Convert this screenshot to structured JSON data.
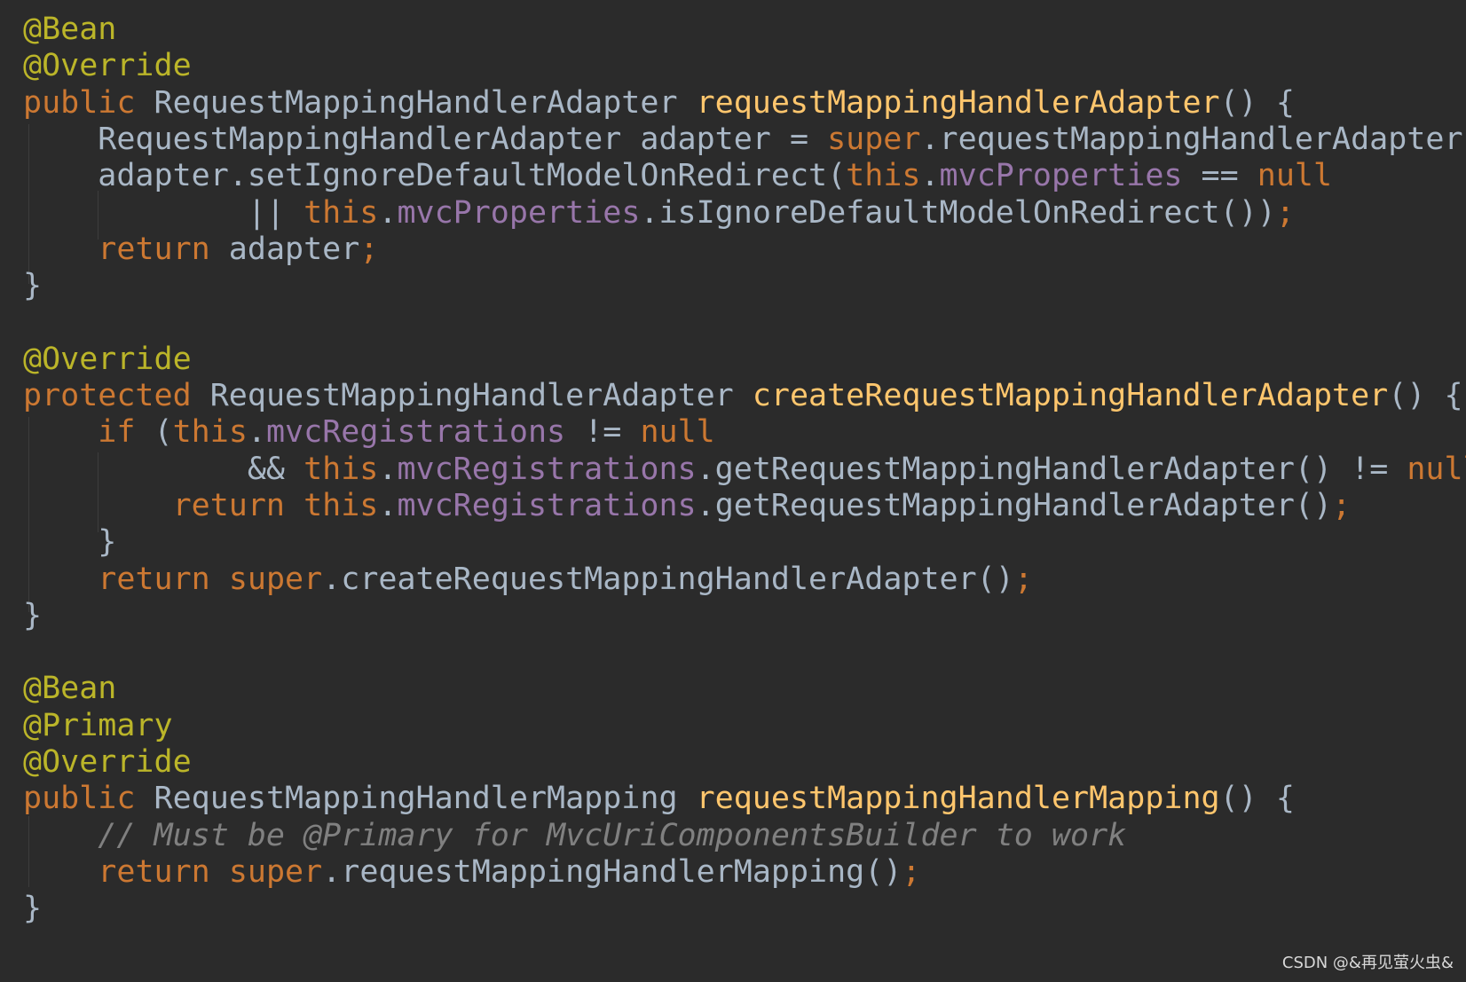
{
  "editor": {
    "background": "#2b2b2b",
    "colors": {
      "annotation": "#bbb529",
      "keyword": "#cc7832",
      "method": "#ffc66d",
      "field": "#9876aa",
      "comment": "#808080",
      "text": "#a9b7c6"
    },
    "lines": [
      [
        {
          "t": "@Bean",
          "c": "ann"
        }
      ],
      [
        {
          "t": "@Override",
          "c": "ann"
        }
      ],
      [
        {
          "t": "public",
          "c": "kw"
        },
        {
          "t": " RequestMappingHandlerAdapter ",
          "c": "plain"
        },
        {
          "t": "requestMappingHandlerAdapter",
          "c": "fn"
        },
        {
          "t": "() {",
          "c": "plain"
        }
      ],
      [
        {
          "t": "    RequestMappingHandlerAdapter adapter = ",
          "c": "plain"
        },
        {
          "t": "super",
          "c": "kw"
        },
        {
          "t": ".requestMappingHandlerAdapter()",
          "c": "plain"
        },
        {
          "t": ";",
          "c": "kw"
        }
      ],
      [
        {
          "t": "    adapter.setIgnoreDefaultModelOnRedirect(",
          "c": "plain"
        },
        {
          "t": "this",
          "c": "kw"
        },
        {
          "t": ".",
          "c": "plain"
        },
        {
          "t": "mvcProperties",
          "c": "field"
        },
        {
          "t": " == ",
          "c": "plain"
        },
        {
          "t": "null",
          "c": "kw"
        }
      ],
      [
        {
          "t": "            || ",
          "c": "plain"
        },
        {
          "t": "this",
          "c": "kw"
        },
        {
          "t": ".",
          "c": "plain"
        },
        {
          "t": "mvcProperties",
          "c": "field"
        },
        {
          "t": ".isIgnoreDefaultModelOnRedirect())",
          "c": "plain"
        },
        {
          "t": ";",
          "c": "kw"
        }
      ],
      [
        {
          "t": "    ",
          "c": "plain"
        },
        {
          "t": "return",
          "c": "kw"
        },
        {
          "t": " adapter",
          "c": "plain"
        },
        {
          "t": ";",
          "c": "kw"
        }
      ],
      [
        {
          "t": "}",
          "c": "plain"
        }
      ],
      [],
      [
        {
          "t": "@Override",
          "c": "ann"
        }
      ],
      [
        {
          "t": "protected",
          "c": "kw"
        },
        {
          "t": " RequestMappingHandlerAdapter ",
          "c": "plain"
        },
        {
          "t": "createRequestMappingHandlerAdapter",
          "c": "fn"
        },
        {
          "t": "() {",
          "c": "plain"
        }
      ],
      [
        {
          "t": "    ",
          "c": "plain"
        },
        {
          "t": "if",
          "c": "kw"
        },
        {
          "t": " (",
          "c": "plain"
        },
        {
          "t": "this",
          "c": "kw"
        },
        {
          "t": ".",
          "c": "plain"
        },
        {
          "t": "mvcRegistrations",
          "c": "field"
        },
        {
          "t": " != ",
          "c": "plain"
        },
        {
          "t": "null",
          "c": "kw"
        }
      ],
      [
        {
          "t": "            && ",
          "c": "plain"
        },
        {
          "t": "this",
          "c": "kw"
        },
        {
          "t": ".",
          "c": "plain"
        },
        {
          "t": "mvcRegistrations",
          "c": "field"
        },
        {
          "t": ".getRequestMappingHandlerAdapter() != ",
          "c": "plain"
        },
        {
          "t": "null",
          "c": "kw"
        },
        {
          "t": ") {",
          "c": "plain"
        }
      ],
      [
        {
          "t": "        ",
          "c": "plain"
        },
        {
          "t": "return",
          "c": "kw"
        },
        {
          "t": " ",
          "c": "plain"
        },
        {
          "t": "this",
          "c": "kw"
        },
        {
          "t": ".",
          "c": "plain"
        },
        {
          "t": "mvcRegistrations",
          "c": "field"
        },
        {
          "t": ".getRequestMappingHandlerAdapter()",
          "c": "plain"
        },
        {
          "t": ";",
          "c": "kw"
        }
      ],
      [
        {
          "t": "    }",
          "c": "plain"
        }
      ],
      [
        {
          "t": "    ",
          "c": "plain"
        },
        {
          "t": "return",
          "c": "kw"
        },
        {
          "t": " ",
          "c": "plain"
        },
        {
          "t": "super",
          "c": "kw"
        },
        {
          "t": ".createRequestMappingHandlerAdapter()",
          "c": "plain"
        },
        {
          "t": ";",
          "c": "kw"
        }
      ],
      [
        {
          "t": "}",
          "c": "plain"
        }
      ],
      [],
      [
        {
          "t": "@Bean",
          "c": "ann"
        }
      ],
      [
        {
          "t": "@Primary",
          "c": "ann"
        }
      ],
      [
        {
          "t": "@Override",
          "c": "ann"
        }
      ],
      [
        {
          "t": "public",
          "c": "kw"
        },
        {
          "t": " RequestMappingHandlerMapping ",
          "c": "plain"
        },
        {
          "t": "requestMappingHandlerMapping",
          "c": "fn"
        },
        {
          "t": "() {",
          "c": "plain"
        }
      ],
      [
        {
          "t": "    // Must be @Primary for MvcUriComponentsBuilder to work",
          "c": "cmt"
        }
      ],
      [
        {
          "t": "    ",
          "c": "plain"
        },
        {
          "t": "return",
          "c": "kw"
        },
        {
          "t": " ",
          "c": "plain"
        },
        {
          "t": "super",
          "c": "kw"
        },
        {
          "t": ".requestMappingHandlerMapping()",
          "c": "plain"
        },
        {
          "t": ";",
          "c": "kw"
        }
      ],
      [
        {
          "t": "}",
          "c": "plain"
        }
      ]
    ]
  },
  "watermark": "CSDN @&再见萤火虫&"
}
